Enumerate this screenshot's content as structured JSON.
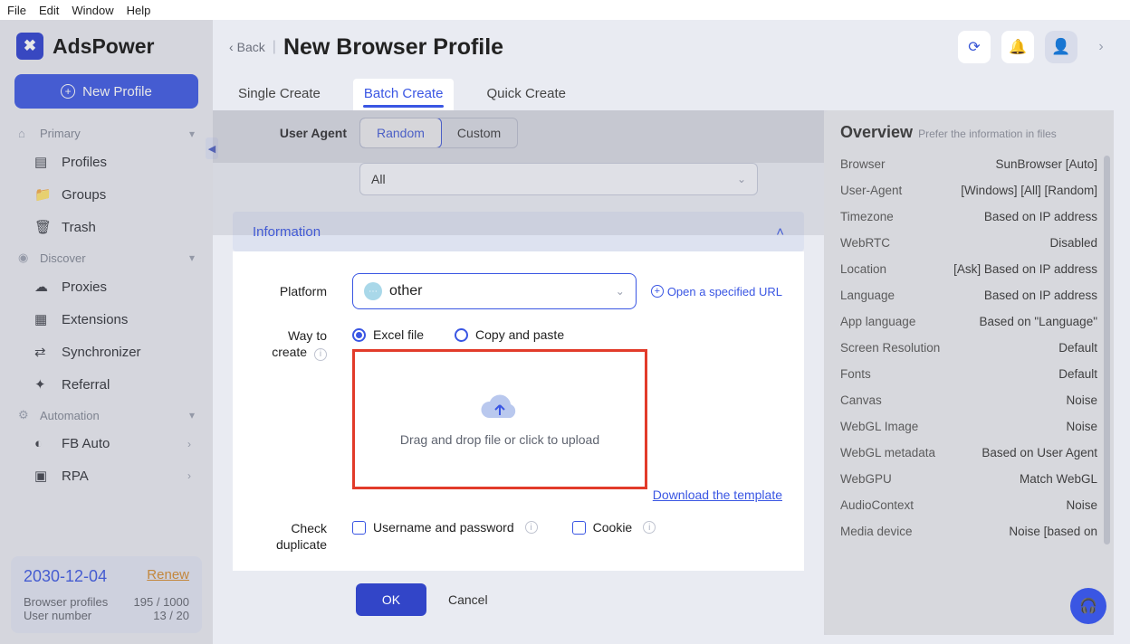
{
  "menubar": [
    "File",
    "Edit",
    "Window",
    "Help"
  ],
  "brand": "AdsPower",
  "sidebar": {
    "new_profile": "New Profile",
    "sections": {
      "primary": "Primary",
      "discover": "Discover",
      "automation": "Automation"
    },
    "items": {
      "profiles": "Profiles",
      "groups": "Groups",
      "trash": "Trash",
      "proxies": "Proxies",
      "extensions": "Extensions",
      "synchronizer": "Synchronizer",
      "referral": "Referral",
      "fb_auto": "FB Auto",
      "rpa": "RPA"
    },
    "renew": {
      "date": "2030-12-04",
      "renew_label": "Renew",
      "rows": [
        {
          "k": "Browser profiles",
          "v": "195 / 1000"
        },
        {
          "k": "User number",
          "v": "13 / 20"
        }
      ]
    }
  },
  "header": {
    "back": "Back",
    "title": "New Browser Profile"
  },
  "tabs": {
    "single": "Single Create",
    "batch": "Batch Create",
    "quick": "Quick Create"
  },
  "form": {
    "user_agent_label": "User Agent",
    "ua_random": "Random",
    "ua_custom": "Custom",
    "ua_all": "All",
    "information": "Information",
    "platform_label": "Platform",
    "platform_value": "other",
    "open_url": "Open a specified URL",
    "way_label": "Way to create",
    "way_excel": "Excel file",
    "way_copy": "Copy and paste",
    "upload_text": "Drag and drop file or click to upload",
    "download_template": "Download the template",
    "check_dup_label": "Check duplicate",
    "chk_user_pass": "Username and password",
    "chk_cookie": "Cookie",
    "ok": "OK",
    "cancel": "Cancel"
  },
  "overview": {
    "title": "Overview",
    "subtitle": "Prefer the information in files",
    "rows": [
      {
        "k": "Browser",
        "v": "SunBrowser [Auto]"
      },
      {
        "k": "User-Agent",
        "v": "[Windows] [All] [Random]"
      },
      {
        "k": "Timezone",
        "v": "Based on IP address"
      },
      {
        "k": "WebRTC",
        "v": "Disabled"
      },
      {
        "k": "Location",
        "v": "[Ask] Based on IP address"
      },
      {
        "k": "Language",
        "v": "Based on IP address"
      },
      {
        "k": "App language",
        "v": "Based on \"Language\""
      },
      {
        "k": "Screen Resolution",
        "v": "Default"
      },
      {
        "k": "Fonts",
        "v": "Default"
      },
      {
        "k": "Canvas",
        "v": "Noise"
      },
      {
        "k": "WebGL Image",
        "v": "Noise"
      },
      {
        "k": "WebGL metadata",
        "v": "Based on User Agent"
      },
      {
        "k": "WebGPU",
        "v": "Match WebGL"
      },
      {
        "k": "AudioContext",
        "v": "Noise"
      },
      {
        "k": "Media device",
        "v": "Noise [based on"
      }
    ]
  }
}
